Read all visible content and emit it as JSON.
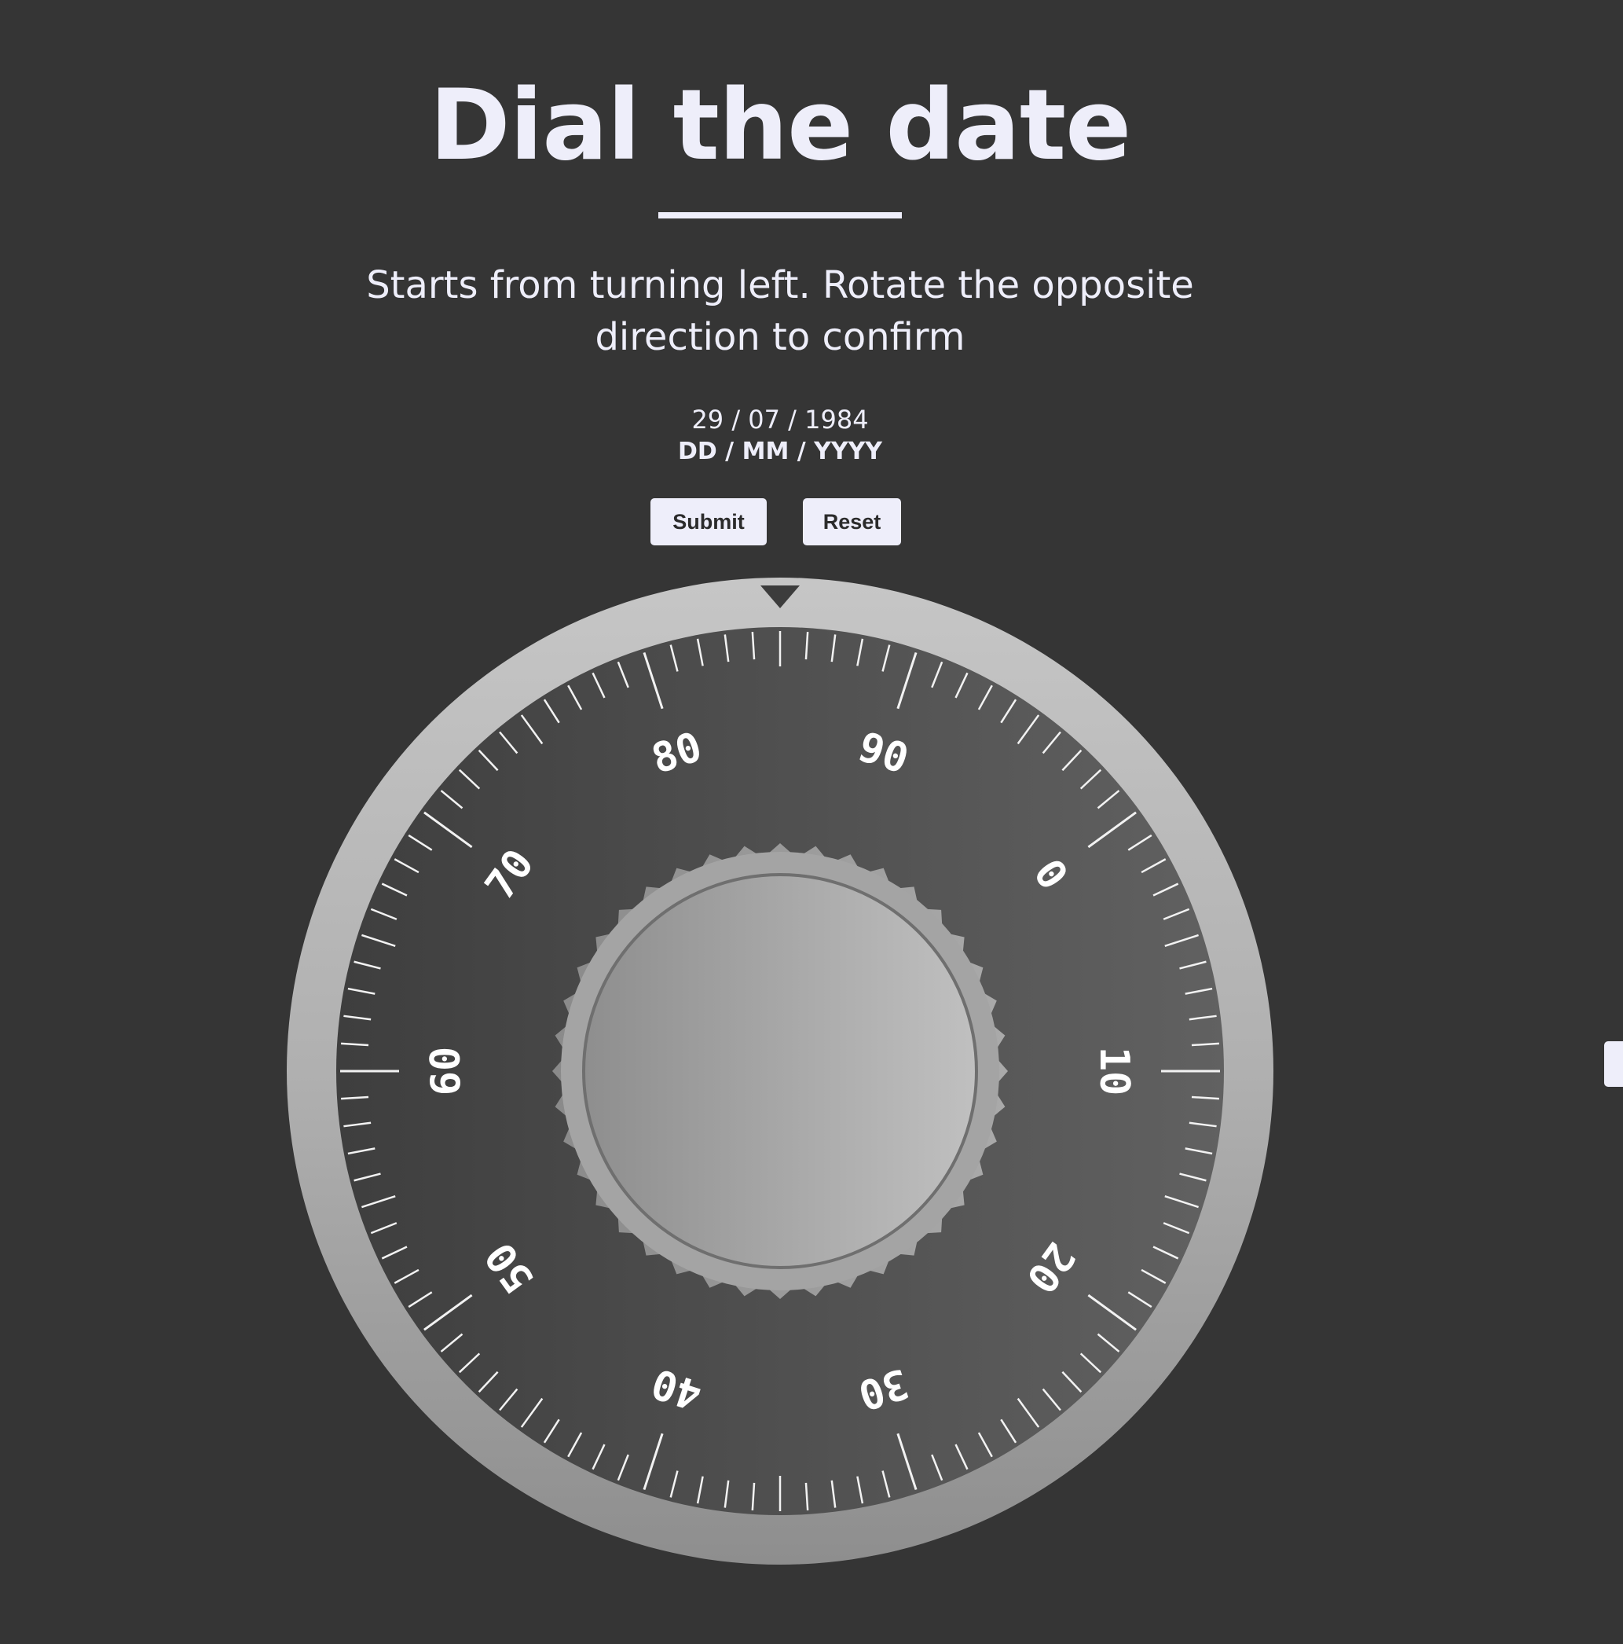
{
  "title": "Dial the date",
  "instructions": "Starts from turning left. Rotate the opposite direction to confirm",
  "date": {
    "value": "29 / 07 / 1984",
    "format": "DD / MM / YYYY"
  },
  "buttons": {
    "submit": "Submit",
    "reset": "Reset"
  },
  "dial": {
    "numbers": [
      "0",
      "10",
      "20",
      "30",
      "40",
      "50",
      "60",
      "70",
      "80",
      "90"
    ],
    "total_ticks": 100,
    "number_step": 10,
    "rotation_offset_ticks": 15,
    "indicator": "triangle-pointer-icon"
  },
  "colors": {
    "background": "#353535",
    "text": "#eeeefa",
    "button_bg": "#eeeefa",
    "button_text": "#2b2b2b",
    "dial_face": "#4a4a4a",
    "dial_rim": "#b4b4b4"
  }
}
